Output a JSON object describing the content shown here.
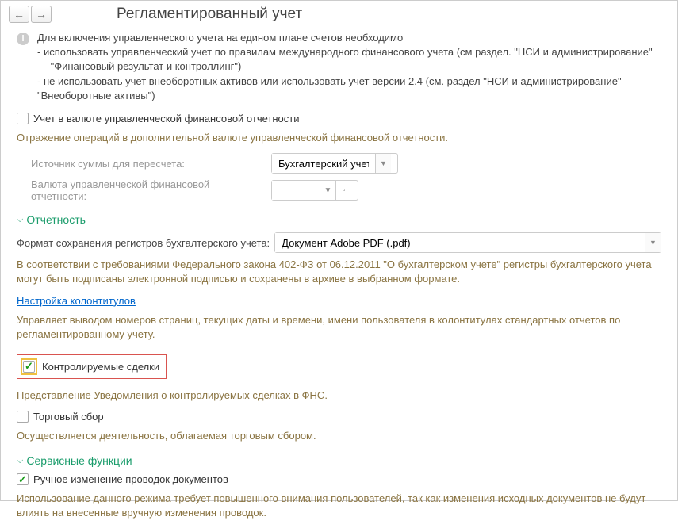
{
  "header": {
    "title": "Регламентированный учет"
  },
  "info": {
    "line1": "Для включения управленческого учета на едином плане счетов необходимо",
    "line2": " - использовать управленческий учет по правилам международного финансового учета (см раздел. \"НСИ и администрирование\" — \"Финансовый результат и контроллинг\")",
    "line3": " - не использовать учет внеоборотных активов или использовать учет версии 2.4 (см. раздел \"НСИ и администрирование\" — \"Внеоборотные активы\")"
  },
  "currency": {
    "checkbox_label": "Учет в валюте управленческой финансовой отчетности",
    "desc": "Отражение операций в дополнительной валюте управленческой финансовой отчетности.",
    "source_label": "Источник суммы для пересчета:",
    "source_value": "Бухгалтерский учет",
    "currency_label": "Валюта управленческой финансовой отчетности:"
  },
  "reporting": {
    "section_title": "Отчетность",
    "format_label": "Формат сохранения регистров бухгалтерского учета:",
    "format_value": "Документ Adobe PDF (.pdf)",
    "law_desc": "В соответствии с требованиями Федерального закона 402-ФЗ от 06.12.2011 \"О бухгалтерском учете\" регистры бухгалтерского учета могут быть подписаны электронной подписью и сохранены в архиве в выбранном формате.",
    "link": "Настройка колонтитулов",
    "header_desc": "Управляет выводом номеров страниц, текущих даты и времени, имени пользователя в колонтитулах стандартных отчетов по регламентированному учету.",
    "controlled_label": "Контролируемые сделки",
    "controlled_desc": "Представление Уведомления о контролируемых сделках в ФНС.",
    "trade_label": "Торговый сбор",
    "trade_desc": "Осуществляется деятельность, облагаемая торговым сбором."
  },
  "service": {
    "section_title": "Сервисные функции",
    "manual_label": "Ручное изменение проводок документов",
    "manual_desc": "Использование данного режима требует повышенного внимания пользователей, так как изменения исходных документов не будут влиять на внесенные вручную изменения проводок."
  }
}
